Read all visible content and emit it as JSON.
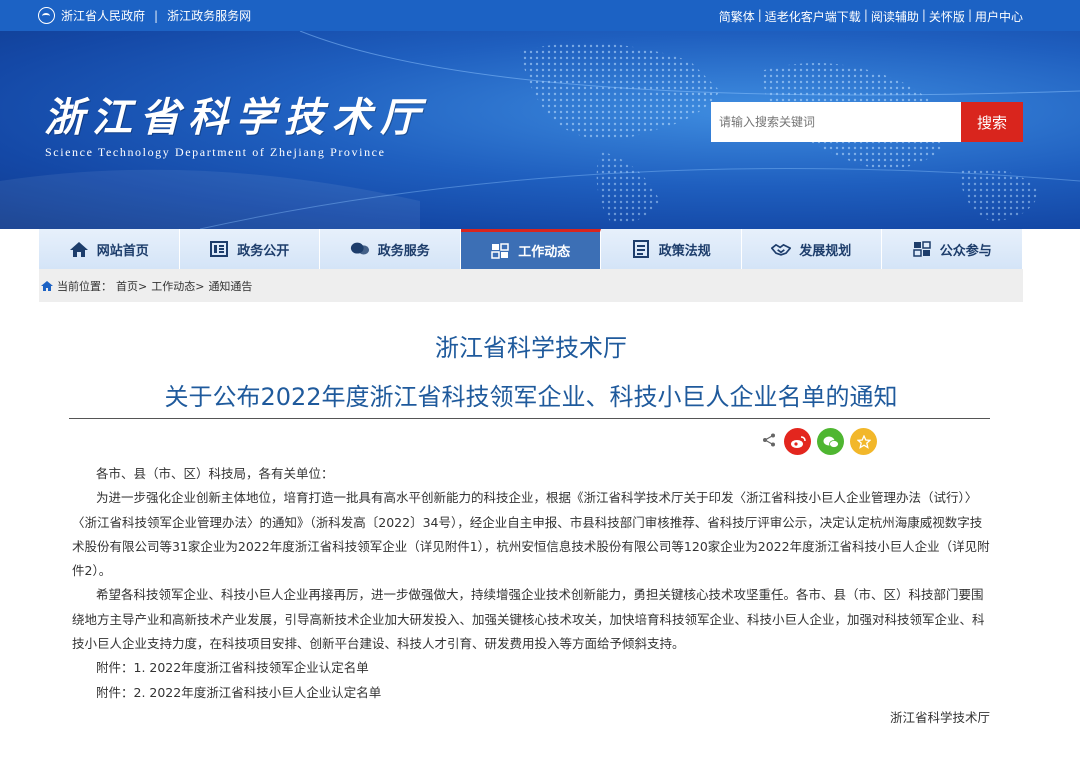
{
  "topbar": {
    "left_links": [
      "浙江省人民政府",
      "浙江政务服务网"
    ],
    "separator": "|",
    "right_links": [
      "简繁体",
      "适老化客户端下载",
      "阅读辅助",
      "关怀版",
      "用户中心"
    ]
  },
  "banner": {
    "title": "浙江省科学技术厅",
    "subtitle": "Science Technology Department of Zhejiang Province",
    "search_placeholder": "请输入搜索关键词",
    "search_button": "搜索"
  },
  "nav": {
    "items": [
      {
        "label": "网站首页",
        "icon": "home-icon"
      },
      {
        "label": "政务公开",
        "icon": "document-icon"
      },
      {
        "label": "政务服务",
        "icon": "chat-icon"
      },
      {
        "label": "工作动态",
        "icon": "tasks-icon"
      },
      {
        "label": "政策法规",
        "icon": "list-icon"
      },
      {
        "label": "发展规划",
        "icon": "handshake-icon"
      },
      {
        "label": "公众参与",
        "icon": "people-icon"
      }
    ],
    "active_index": 3
  },
  "breadcrumb": {
    "prefix": "当前位置：",
    "items": [
      "首页>",
      "工作动态>",
      "通知通告"
    ]
  },
  "article": {
    "title_line1": "浙江省科学技术厅",
    "title_line2": "关于公布2022年度浙江省科技领军企业、科技小巨人企业名单的通知",
    "salutation": "各市、县（市、区）科技局，各有关单位：",
    "paragraph1": "为进一步强化企业创新主体地位，培育打造一批具有高水平创新能力的科技企业，根据《浙江省科学技术厅关于印发〈浙江省科技小巨人企业管理办法（试行）〉〈浙江省科技领军企业管理办法〉的通知》（浙科发高〔2022〕34号），经企业自主申报、市县科技部门审核推荐、省科技厅评审公示，决定认定杭州海康威视数字技术股份有限公司等31家企业为2022年度浙江省科技领军企业（详见附件1），杭州安恒信息技术股份有限公司等120家企业为2022年度浙江省科技小巨人企业（详见附件2）。",
    "paragraph2": "希望各科技领军企业、科技小巨人企业再接再厉，进一步做强做大，持续增强企业技术创新能力，勇担关键核心技术攻坚重任。各市、县（市、区）科技部门要围绕地方主导产业和高新技术产业发展，引导高新技术企业加大研发投入、加强关键核心技术攻关，加快培育科技领军企业、科技小巨人企业，加强对科技领军企业、科技小巨人企业支持力度，在科技项目安排、创新平台建设、科技人才引育、研发费用投入等方面给予倾斜支持。",
    "attachment1": "附件：1. 2022年度浙江省科技领军企业认定名单",
    "attachment2": "附件：2. 2022年度浙江省科技小巨人企业认定名单",
    "signature": "浙江省科学技术厅"
  },
  "colors": {
    "topbar": "#1c62c4",
    "accent_red": "#d9251d",
    "title_blue": "#1f5a9c",
    "nav_active": "#3c6fb5"
  }
}
